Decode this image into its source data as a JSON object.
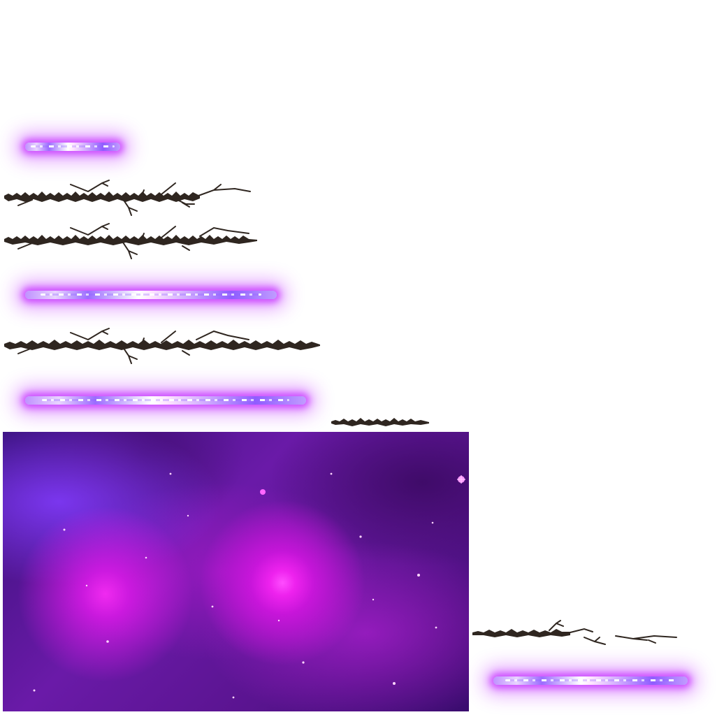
{
  "sheet": {
    "background_color": "#ffffff",
    "beam_glow_color": "#c83cff",
    "branch_color": "#2f2620"
  },
  "sprites": [
    {
      "name": "beam-short",
      "type": "energy-beam"
    },
    {
      "name": "branch-cracked-1",
      "type": "thorn-branch"
    },
    {
      "name": "branch-cracked-2",
      "type": "thorn-branch"
    },
    {
      "name": "beam-medium",
      "type": "energy-beam"
    },
    {
      "name": "branch-long",
      "type": "thorn-branch"
    },
    {
      "name": "beam-long",
      "type": "energy-beam"
    },
    {
      "name": "branch-small",
      "type": "thorn-branch"
    },
    {
      "name": "nebula-background",
      "type": "background"
    },
    {
      "name": "branch-broken",
      "type": "thorn-branch"
    },
    {
      "name": "beam-right",
      "type": "energy-beam"
    }
  ]
}
